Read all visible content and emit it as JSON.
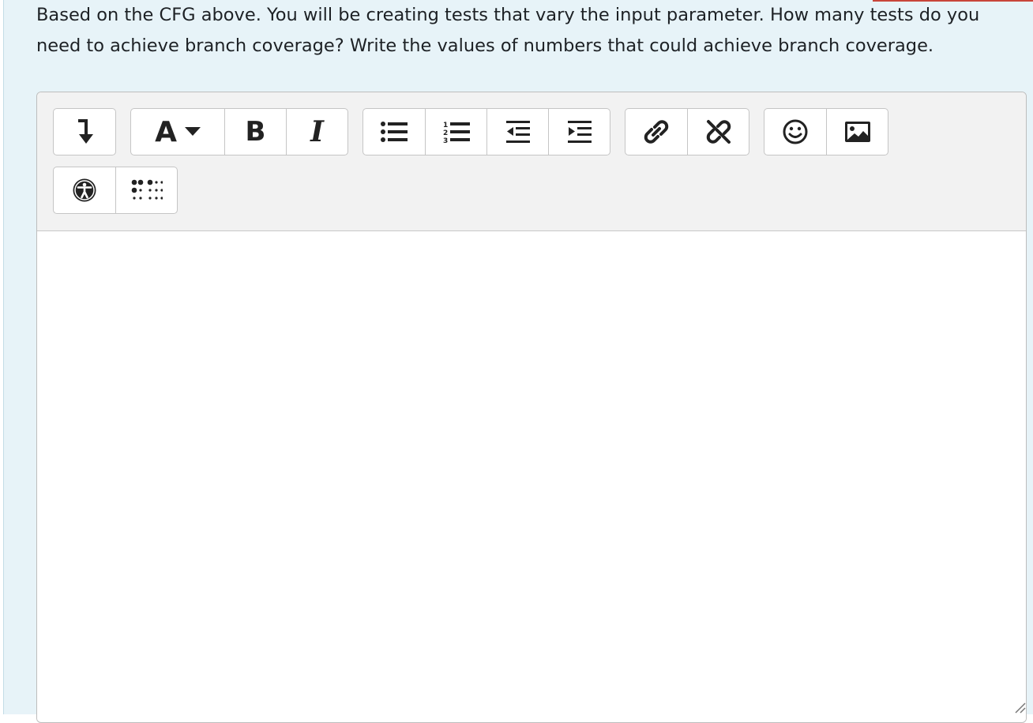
{
  "question": {
    "text": "Based on the CFG above.  You will be creating tests that vary the input parameter. How many tests do you need to achieve branch coverage? Write the values of numbers that could achieve branch coverage."
  },
  "editor": {
    "content": "",
    "toolbar": {
      "row1": [
        {
          "icon": "collapse-arrow-icon"
        },
        {
          "icon": "font-style-dropdown-icon",
          "label": "A"
        },
        {
          "icon": "bold-icon",
          "label": "B"
        },
        {
          "icon": "italic-icon",
          "label": "I"
        },
        {
          "icon": "unordered-list-icon"
        },
        {
          "icon": "ordered-list-icon"
        },
        {
          "icon": "outdent-icon"
        },
        {
          "icon": "indent-icon"
        },
        {
          "icon": "link-icon"
        },
        {
          "icon": "unlink-icon"
        },
        {
          "icon": "emoji-icon"
        },
        {
          "icon": "image-icon"
        }
      ],
      "row2": [
        {
          "icon": "accessibility-icon"
        },
        {
          "icon": "braille-icon"
        }
      ]
    }
  },
  "colors": {
    "panel_bg": "#e7f3f8",
    "toolbar_bg": "#f2f2f2",
    "accent_red": "#c9453a",
    "text": "#1d2125"
  }
}
